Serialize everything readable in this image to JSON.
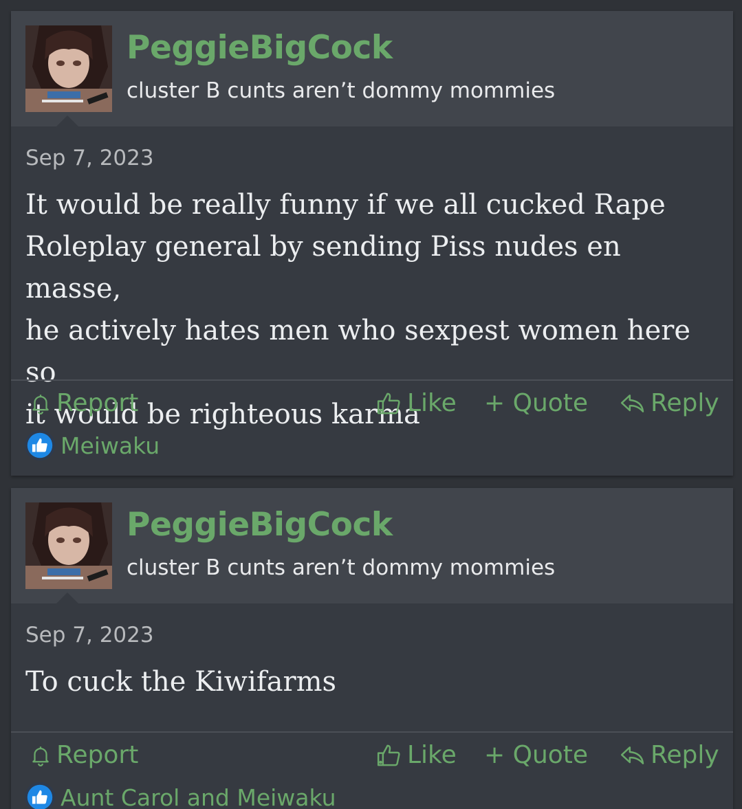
{
  "posts": [
    {
      "username": "PeggieBigCock",
      "user_title": "cluster B cunts aren’t dommy mommies",
      "date": "Sep 7, 2023",
      "body_lines": [
        "It would be really funny if we all cucked Rape",
        "Roleplay general by sending Piss nudes en masse,",
        "he actively hates men who sexpest women here so",
        "it would be righteous karma"
      ],
      "actions": {
        "report": "Report",
        "like": "Like",
        "quote": "+ Quote",
        "reply": "Reply"
      },
      "reactions": {
        "icon": "thumbs-up-icon",
        "users": "Meiwaku"
      }
    },
    {
      "username": "PeggieBigCock",
      "user_title": "cluster B cunts aren’t dommy mommies",
      "date": "Sep 7, 2023",
      "body_lines": [
        "To cuck the Kiwifarms"
      ],
      "actions": {
        "report": "Report",
        "like": "Like",
        "quote": "+ Quote",
        "reply": "Reply"
      },
      "reactions": {
        "icon": "thumbs-up-icon",
        "users": "Aunt Carol and Meiwaku"
      }
    }
  ],
  "colors": {
    "background": "#2f3237",
    "post_body": "#363a41",
    "user_header": "#41454c",
    "link_green": "#6aa86a",
    "reaction_blue": "#1e88e5"
  }
}
